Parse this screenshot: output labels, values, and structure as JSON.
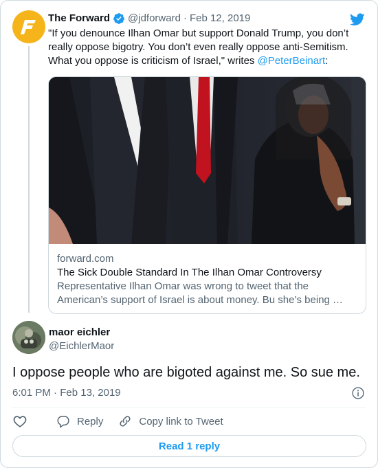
{
  "quoted": {
    "name": "The Forward",
    "handle": "@jdforward",
    "separator": "·",
    "date": "Feb 12, 2019",
    "text": "\"If you denounce Ilhan Omar but support Donald Trump, you don’t really oppose bigotry. You don’t even really oppose anti-Semitism. What you oppose is criticism of Israel,\" writes ",
    "mention": "@PeterBeinart",
    "text_end": ":",
    "link": {
      "domain": "forward.com",
      "title": "The Sick Double Standard In The Ilhan Omar Controversy",
      "description_line1": "Representative Ilhan Omar was wrong to tweet that the",
      "description_line2": "American’s support of Israel is about money. Bu she’s being …"
    }
  },
  "tweet": {
    "name": "maor eichler",
    "handle": "@EichlerMaor",
    "text": "I oppose people who are bigoted against me. So sue me.",
    "time": "6:01 PM",
    "separator": "·",
    "date": "Feb 13, 2019"
  },
  "actions": {
    "reply_label": "Reply",
    "copy_label": "Copy link to Tweet"
  },
  "read_reply_label": "Read 1 reply",
  "icons": {
    "brand_logo": "forward-logo-icon",
    "verified": "verified-badge-icon",
    "platform": "twitter-bird-icon",
    "info": "info-icon",
    "like": "heart-icon",
    "reply": "reply-bubble-icon",
    "copy": "link-icon"
  },
  "colors": {
    "accent": "#1d9bf0",
    "text": "#0f1419",
    "muted": "#536471",
    "border": "#cfd9de",
    "brand": "#f5b41a"
  }
}
